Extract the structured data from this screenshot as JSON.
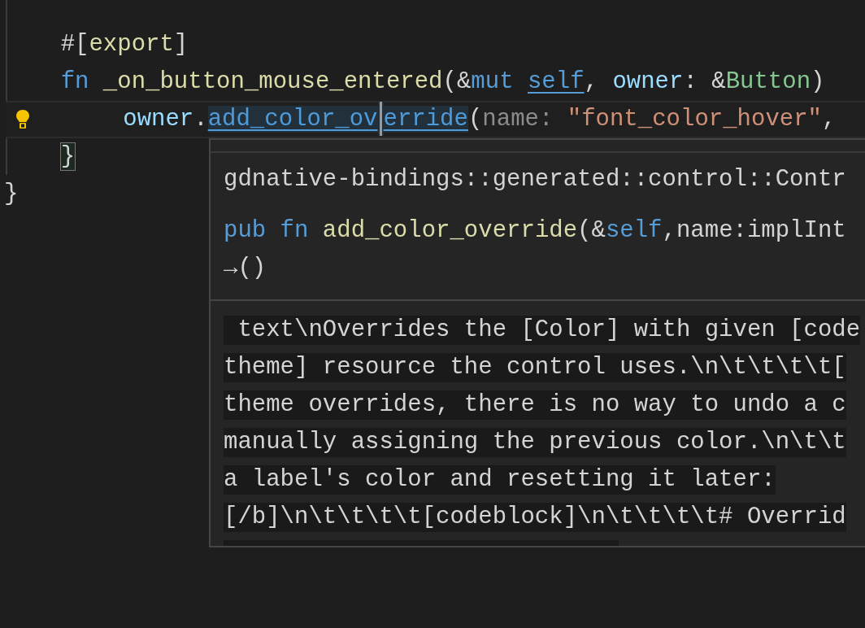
{
  "editor": {
    "lines": [
      {
        "current": false,
        "lightbulb": false,
        "tokens": [
          {
            "text": "    #[",
            "kind": "punct",
            "selected": false
          },
          {
            "text": "export",
            "kind": "attr",
            "selected": false
          },
          {
            "text": "]",
            "kind": "punct",
            "selected": false
          }
        ]
      },
      {
        "current": false,
        "lightbulb": false,
        "tokens": [
          {
            "text": "    fn",
            "kind": "keyword",
            "selected": false
          },
          {
            "text": " _on_button_mouse_entered",
            "kind": "function",
            "selected": false
          },
          {
            "text": "(&",
            "kind": "punct",
            "selected": false
          },
          {
            "text": "mut",
            "kind": "keyword",
            "selected": false
          },
          {
            "text": " self",
            "kind": "keyword_ref",
            "selected": false
          },
          {
            "text": ", ",
            "kind": "punct",
            "selected": false
          },
          {
            "text": "owner",
            "kind": "param",
            "selected": false
          },
          {
            "text": ": &",
            "kind": "punct",
            "selected": false
          },
          {
            "text": "Button",
            "kind": "type",
            "selected": false
          },
          {
            "text": ")",
            "kind": "punct",
            "selected": false
          }
        ]
      },
      {
        "current": true,
        "lightbulb": true,
        "tokens": [
          {
            "text": "        owner",
            "kind": "param",
            "selected": false
          },
          {
            "text": ".",
            "kind": "punct",
            "selected": false
          },
          {
            "text": "add_color_ov",
            "kind": "reference",
            "selected": true
          },
          {
            "kind": "caret",
            "selected": true
          },
          {
            "text": "erride",
            "kind": "reference",
            "selected": true
          },
          {
            "text": "(",
            "kind": "punct",
            "selected": false
          },
          {
            "text": "name: ",
            "kind": "hint",
            "selected": false
          },
          {
            "text": "\"font_color_hover\"",
            "kind": "string",
            "selected": false
          },
          {
            "text": ",",
            "kind": "punct",
            "selected": false
          }
        ]
      },
      {
        "current": false,
        "lightbulb": false,
        "tokens": [
          {
            "text": "    }",
            "kind": "matched_bracket",
            "selected": false
          }
        ]
      },
      {
        "current": false,
        "lightbulb": false,
        "tokens": [
          {
            "text": "}",
            "kind": "punct",
            "selected": false
          }
        ]
      }
    ]
  },
  "hover": {
    "path": "gdnative-bindings::generated::control::Contr",
    "signature": [
      {
        "text": "pub",
        "kind": "keyword"
      },
      {
        "text": " fn",
        "kind": "keyword"
      },
      {
        "text": " add_color_override",
        "kind": "function"
      },
      {
        "text": "(&",
        "kind": "punct"
      },
      {
        "text": "self",
        "kind": "keyword"
      },
      {
        "text": ",name:implInt",
        "kind": "punct"
      }
    ],
    "signature_cont": "→()",
    "doc_lines": [
      " text\\nOverrides the [Color] with given [code",
      "theme] resource the control uses.\\n\\t\\t\\t\\t[",
      "theme overrides, there is no way to undo a c",
      "manually assigning the previous color.\\n\\t\\t",
      "a label's color and resetting it later:",
      "[/b]\\n\\t\\t\\t\\t[codeblock]\\n\\t\\t\\t\\t# Overrid"
    ]
  }
}
